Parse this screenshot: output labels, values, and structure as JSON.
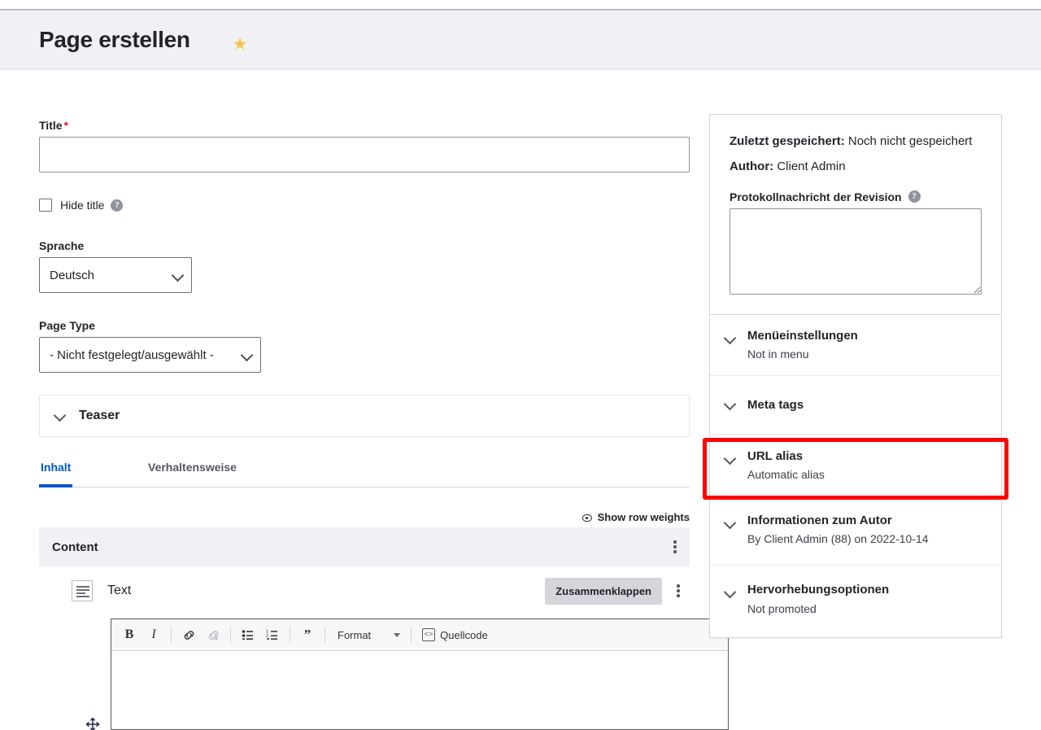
{
  "header": {
    "title": "Page erstellen",
    "star_icon": "star-icon"
  },
  "form": {
    "title_label": "Title",
    "title_required_mark": "*",
    "title_value": "",
    "title_placeholder": "",
    "hide_title_label": "Hide title",
    "hide_title_checked": false,
    "language_label": "Sprache",
    "language_value": "Deutsch",
    "language_options": [
      "Deutsch"
    ],
    "page_type_label": "Page Type",
    "page_type_value": "- Nicht festgelegt/ausgewählt -",
    "page_type_options": [
      "- Nicht festgelegt/ausgewählt -"
    ],
    "teaser_label": "Teaser"
  },
  "tabs": [
    {
      "label": "Inhalt",
      "active": true
    },
    {
      "label": "Verhaltensweise",
      "active": false
    }
  ],
  "content": {
    "show_row_weights": "Show row weights",
    "band_title": "Content",
    "paragraph_label": "Text",
    "collapse_button": "Zusammenklappen",
    "editor": {
      "bold": "B",
      "italic": "I",
      "format_label": "Format",
      "source_label": "Quellcode",
      "body_value": "",
      "tools": [
        "bold-icon",
        "italic-icon",
        "link-icon",
        "unlink-icon",
        "bulleted-list-icon",
        "numbered-list-icon",
        "blockquote-icon",
        "format-dropdown",
        "source-code-icon"
      ]
    }
  },
  "sidebar": {
    "last_saved_label": "Zuletzt gespeichert:",
    "last_saved_value": "Noch nicht gespeichert",
    "author_label": "Author:",
    "author_value": "Client Admin",
    "revision_log_label": "Protokollnachricht der Revision",
    "revision_log_value": "",
    "sections": [
      {
        "title": "Menüeinstellungen",
        "summary": "Not in menu",
        "highlighted": false
      },
      {
        "title": "Meta tags",
        "summary": "",
        "highlighted": true
      },
      {
        "title": "URL alias",
        "summary": "Automatic alias",
        "highlighted": false
      },
      {
        "title": "Informationen zum Autor",
        "summary": "By Client Admin (88) on 2022-10-14",
        "highlighted": false
      },
      {
        "title": "Hervorhebungsoptionen",
        "summary": "Not promoted",
        "highlighted": false
      }
    ]
  },
  "colors": {
    "header_band": "#f0f1f5",
    "accent_blue": "#0b55c9",
    "active_tab_text": "#0056c7",
    "required_red": "#d72222",
    "annotation_red": "#ff0000",
    "star_yellow": "#f5c543",
    "band_grey": "#f0f1f5",
    "button_grey": "#d4d6db"
  }
}
